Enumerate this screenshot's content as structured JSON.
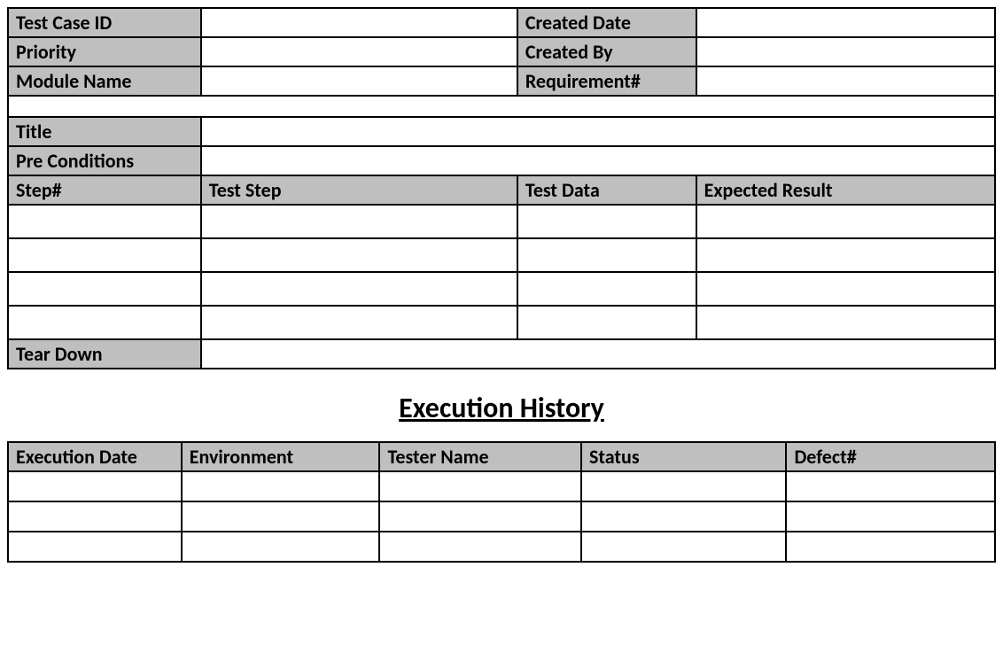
{
  "meta": {
    "test_case_id_label": "Test Case ID",
    "test_case_id_value": "",
    "created_date_label": "Created Date",
    "created_date_value": "",
    "priority_label": "Priority",
    "priority_value": "",
    "created_by_label": "Created By",
    "created_by_value": "",
    "module_name_label": "Module Name",
    "module_name_value": "",
    "requirement_label": "Requirement#",
    "requirement_value": ""
  },
  "details": {
    "title_label": "Title",
    "title_value": "",
    "preconditions_label": "Pre Conditions",
    "preconditions_value": ""
  },
  "steps_header": {
    "step_num": "Step#",
    "test_step": "Test Step",
    "test_data": "Test Data",
    "expected_result": "Expected Result"
  },
  "steps": [
    {
      "num": "",
      "step": "",
      "data": "",
      "expected": ""
    },
    {
      "num": "",
      "step": "",
      "data": "",
      "expected": ""
    },
    {
      "num": "",
      "step": "",
      "data": "",
      "expected": ""
    },
    {
      "num": "",
      "step": "",
      "data": "",
      "expected": ""
    }
  ],
  "teardown": {
    "label": "Tear Down",
    "value": ""
  },
  "history_title": "Execution History",
  "history_header": {
    "date": "Execution Date",
    "env": "Environment",
    "tester": "Tester Name",
    "status": "Status",
    "defect": "Defect#"
  },
  "history": [
    {
      "date": "",
      "env": "",
      "tester": "",
      "status": "",
      "defect": ""
    },
    {
      "date": "",
      "env": "",
      "tester": "",
      "status": "",
      "defect": ""
    },
    {
      "date": "",
      "env": "",
      "tester": "",
      "status": "",
      "defect": ""
    }
  ]
}
